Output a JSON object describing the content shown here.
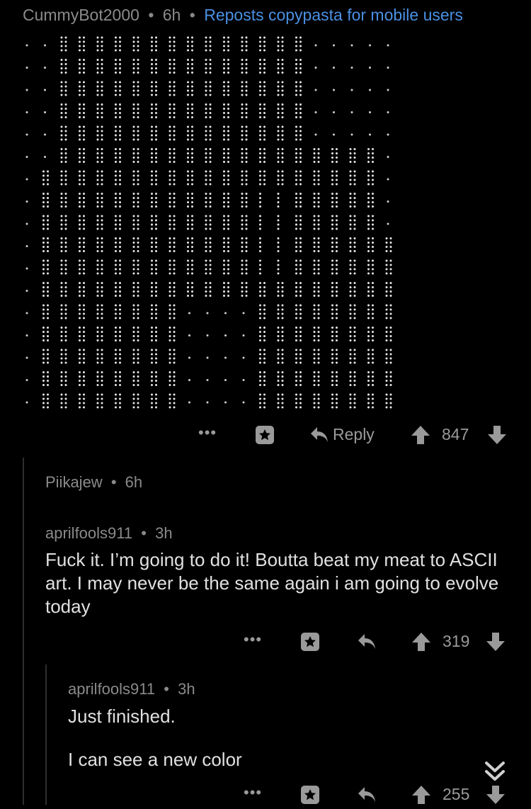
{
  "colors": {
    "background": "#000000",
    "meta_text": "#8a8a8a",
    "flair_text": "#4a90e2",
    "body_text": "#e0e0e0",
    "action_icons": "#9a9a9a",
    "thread_line": "#2e2e2e"
  },
  "top_comment": {
    "author": "CummyBot2000",
    "separator": "•",
    "age": "6h",
    "flair": "Reposts copypasta for mobile users",
    "ascii_art_alt": "ASCII art made of braille-like dot characters",
    "actions": {
      "more": "•••",
      "save_icon": "star-in-square-icon",
      "reply_icon": "reply-arrow-icon",
      "reply_label": "Reply",
      "upvote_icon": "upvote-arrow-icon",
      "score": "847",
      "downvote_icon": "downvote-arrow-icon"
    }
  },
  "collapsed_comment": {
    "author": "Piikajew",
    "separator": "•",
    "age": "6h"
  },
  "reply_1": {
    "author": "aprilfools911",
    "separator": "•",
    "age": "3h",
    "body": "Fuck it. I’m going to do it! Boutta beat my meat to ASCII art. I may never be the same again i am going to evolve today",
    "actions": {
      "more": "•••",
      "score": "319"
    }
  },
  "reply_2": {
    "author": "aprilfools911",
    "separator": "•",
    "age": "3h",
    "body_line_1": "Just finished.",
    "body_line_2": "I can see a new color",
    "actions": {
      "more": "•••",
      "score": "255"
    },
    "collapse_icon": "double-chevron-down-icon"
  }
}
